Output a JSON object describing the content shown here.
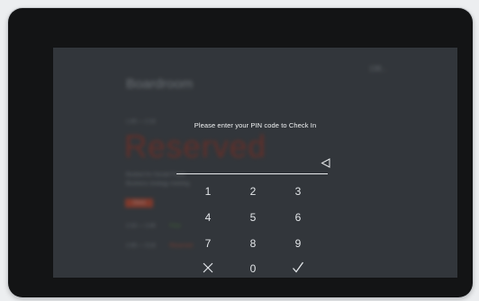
{
  "background": {
    "clock": "138...",
    "room_title": "Boardroom",
    "time_range": "1:45 — 2:15",
    "status": "Reserved",
    "meeting_line1": "Booked for Gerald Frank",
    "meeting_line2": "Business strategy meeting",
    "action_button": "Check",
    "schedule": [
      {
        "time": "2:15 — 2:45",
        "state": "Free"
      },
      {
        "time": "2:45 — 3:15",
        "state": "Reserved"
      }
    ]
  },
  "dialog": {
    "prompt": "Please enter your PIN code to Check In",
    "pin_value": "",
    "keys": {
      "k1": "1",
      "k2": "2",
      "k3": "3",
      "k4": "4",
      "k5": "5",
      "k6": "6",
      "k7": "7",
      "k8": "8",
      "k9": "9",
      "k0": "0"
    },
    "icons": {
      "backspace": "backspace-triangle-icon",
      "cancel": "close-icon",
      "confirm": "checkmark-icon"
    }
  }
}
